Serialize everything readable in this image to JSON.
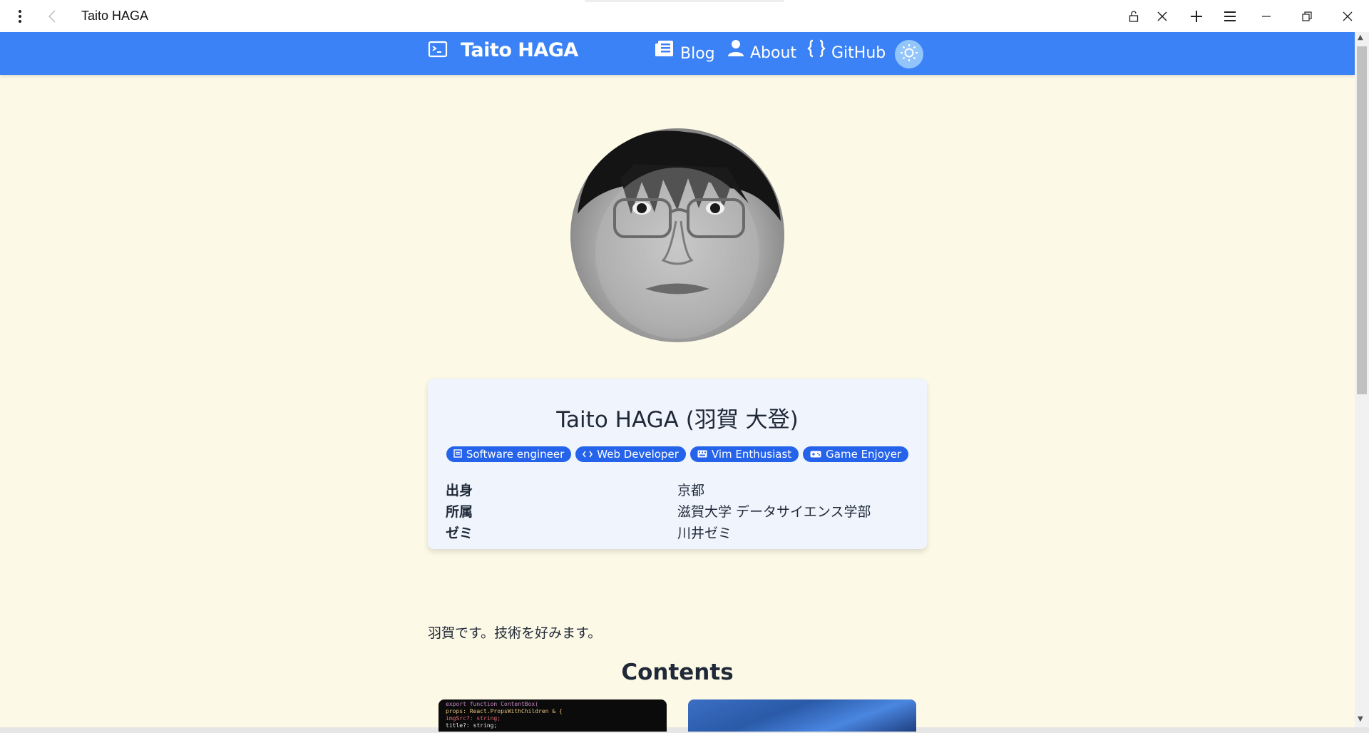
{
  "browser": {
    "title": "Taito HAGA",
    "icons": [
      "more-vert-icon",
      "back-arrow-icon",
      "lock-icon",
      "close-tab-icon",
      "new-tab-icon",
      "menu-icon",
      "minimize-icon",
      "restore-icon",
      "close-window-icon"
    ]
  },
  "nav": {
    "brand": "Taito HAGA",
    "items": [
      {
        "label": "Blog",
        "icon": "newspaper-icon"
      },
      {
        "label": "About",
        "icon": "person-icon"
      },
      {
        "label": "GitHub",
        "icon": "braces-icon"
      }
    ],
    "theme_icon": "sun-icon"
  },
  "profile": {
    "name": "Taito HAGA (羽賀 大登)",
    "tags": [
      {
        "label": "Software engineer",
        "icon": "document-icon"
      },
      {
        "label": "Web Developer",
        "icon": "code-icon"
      },
      {
        "label": "Vim Enthusiast",
        "icon": "keyboard-icon"
      },
      {
        "label": "Game Enjoyer",
        "icon": "gamepad-icon"
      }
    ],
    "info": [
      {
        "key": "出身",
        "value": "京都"
      },
      {
        "key": "所属",
        "value": "滋賀大学 データサイエンス学部"
      },
      {
        "key": "ゼミ",
        "value": "川井ゼミ"
      }
    ]
  },
  "intro": "羽賀です。技術を好みます。",
  "contents_title": "Contents",
  "code_thumb": {
    "lines": [
      "export function ContentBox(",
      "  props: React.PropsWithChildren & {",
      "    imgSrc?: string;",
      "    title?: string;"
    ]
  },
  "colors": {
    "nav_bg": "#3b82f6",
    "page_bg": "#fdf9e7",
    "card_bg": "#eff4fd",
    "tag_bg": "#2563eb"
  }
}
